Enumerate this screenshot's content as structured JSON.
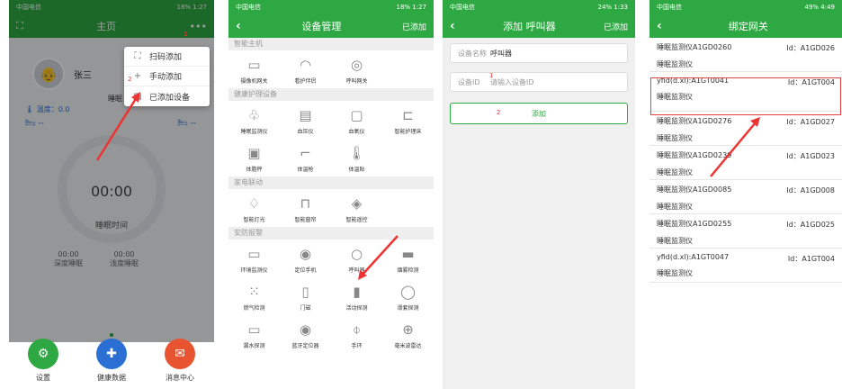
{
  "panel1": {
    "status": {
      "left": "中国电信",
      "right": "18% 1:27"
    },
    "title": "主页",
    "more_icon": "•••",
    "user_name": "张三",
    "sleep_partial": "睡眠",
    "temp_label": "温度：0.0",
    "bed_left": "--",
    "bed_right": "--",
    "time": "00:00",
    "time_label": "睡眠时间",
    "deep": {
      "value": "00:00",
      "label": "深度睡眠"
    },
    "light": {
      "value": "00:00",
      "label": "浅度睡眠"
    },
    "menu": [
      {
        "icon": "scan-icon",
        "glyph": "⛶",
        "label": "扫码添加"
      },
      {
        "icon": "plus-icon",
        "glyph": "+",
        "label": "手动添加"
      },
      {
        "icon": "grid-icon",
        "glyph": "▦",
        "label": "已添加设备"
      }
    ],
    "num1": "1",
    "num2": "2",
    "nav": [
      {
        "label": "设置",
        "color": "#2ea842",
        "glyph": "⚙"
      },
      {
        "label": "健康数据",
        "color": "#2b6fd4",
        "glyph": "✚"
      },
      {
        "label": "消息中心",
        "color": "#e8542f",
        "glyph": "✉"
      }
    ]
  },
  "panel2": {
    "status": {
      "left": "中国电信",
      "right": "18% 1:27"
    },
    "title": "设备管理",
    "right": "已添加",
    "sections": [
      {
        "name": "智能主机",
        "items": [
          "摄像机网关",
          "看护伴侣",
          "呼叫网关"
        ]
      },
      {
        "name": "健康护理设备",
        "items": [
          "睡眠监测仪",
          "血压仪",
          "血氧仪",
          "智能护理床",
          "体脂秤",
          "体温枪",
          "体温贴"
        ]
      },
      {
        "name": "家电联动",
        "items": [
          "智能灯光",
          "智能窗帘",
          "智能遥控"
        ]
      },
      {
        "name": "安防报警",
        "items": [
          "环境监测仪",
          "定位手机",
          "呼叫器",
          "烟雾检测",
          "燃气检测",
          "门磁",
          "活动探测",
          "滑套探测",
          "漏水探测",
          "蓝牙定位器",
          "手环",
          "毫米波雷达"
        ]
      }
    ]
  },
  "panel3": {
    "status": {
      "left": "中国电信",
      "right": "24% 1:33"
    },
    "title": "添加 呼叫器",
    "right": "已添加",
    "name_label": "设备名称",
    "name_value": "呼叫器",
    "id_label": "设备ID",
    "id_placeholder": "请输入设备ID",
    "add_button": "添加",
    "num1": "1",
    "num2": "2"
  },
  "panel4": {
    "status": {
      "left": "中国电信",
      "right": "49% 4:49"
    },
    "title": "绑定网关",
    "rows": [
      {
        "name": "睡眠监测仪A1GD0260",
        "id": "Id：A1GD026",
        "sub": "睡眠监测仪"
      },
      {
        "name": "yfid(d.xl):A1GT0041",
        "id": "Id：A1GT004",
        "sub": "睡眠监测仪"
      },
      {
        "name": "睡眠监测仪A1GD0276",
        "id": "Id：A1GD027",
        "sub": "睡眠监测仪"
      },
      {
        "name": "睡眠监测仪A1GD0239",
        "id": "Id：A1GD023",
        "sub": "睡眠监测仪"
      },
      {
        "name": "睡眠监测仪A1GD0085",
        "id": "Id：A1GD008",
        "sub": "睡眠监测仪"
      },
      {
        "name": "睡眠监测仪A1GD0255",
        "id": "Id：A1GD025",
        "sub": "睡眠监测仪"
      },
      {
        "name": "yfid(d.xl):A1GT0047",
        "id": "Id：A1GT004",
        "sub": "睡眠监测仪"
      }
    ]
  }
}
